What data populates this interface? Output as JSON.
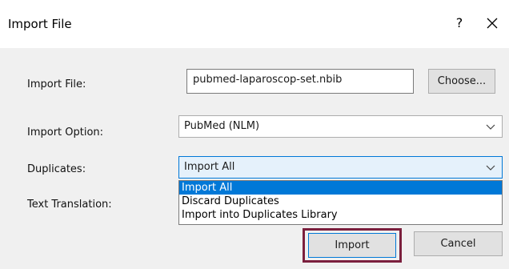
{
  "window": {
    "title": "Import File",
    "help_label": "?"
  },
  "form": {
    "import_file_label": "Import File:",
    "import_file_value": "pubmed-laparoscop-set.nbib",
    "choose_label": "Choose...",
    "import_option_label": "Import Option:",
    "import_option_value": "PubMed (NLM)",
    "duplicates_label": "Duplicates:",
    "duplicates_value": "Import All",
    "duplicates_options": [
      "Import All",
      "Discard Duplicates",
      "Import into Duplicates Library"
    ],
    "text_translation_label": "Text Translation:"
  },
  "buttons": {
    "import_label": "Import",
    "cancel_label": "Cancel"
  },
  "colors": {
    "selection": "#0078d7",
    "highlight_box": "#7b1f3d"
  }
}
